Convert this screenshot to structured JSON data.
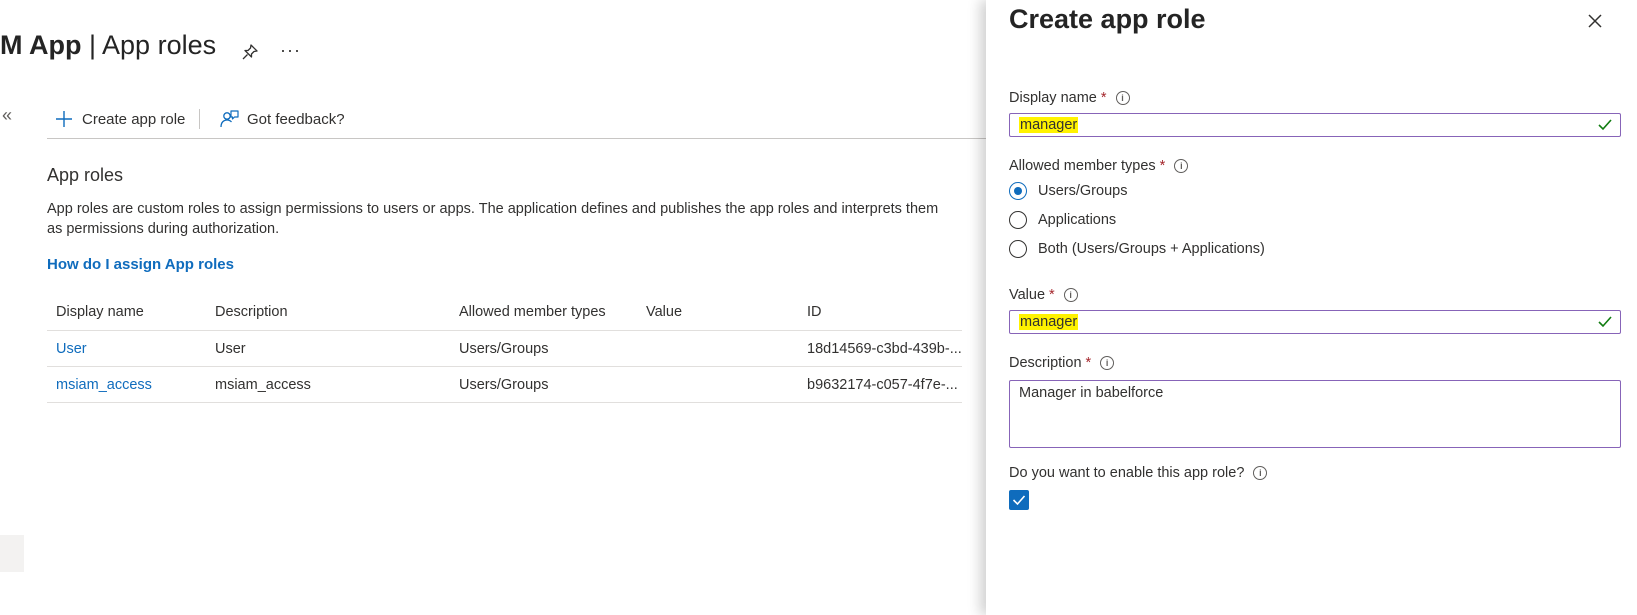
{
  "header": {
    "title_bold": "M App",
    "title_sep": "|",
    "title_rest": "App roles",
    "more_label": "···",
    "collapse_label": "«"
  },
  "toolbar": {
    "create_label": "Create app role",
    "feedback_label": "Got feedback?"
  },
  "section": {
    "title": "App roles",
    "description": "App roles are custom roles to assign permissions to users or apps. The application defines and publishes the app roles and interprets them as permissions during authorization.",
    "help_link": "How do I assign App roles"
  },
  "table": {
    "columns": [
      "Display name",
      "Description",
      "Allowed member types",
      "Value",
      "ID"
    ],
    "rows": [
      {
        "display_name": "User",
        "description": "User",
        "member_types": "Users/Groups",
        "value": "",
        "id": "18d14569-c3bd-439b-..."
      },
      {
        "display_name": "msiam_access",
        "description": "msiam_access",
        "member_types": "Users/Groups",
        "value": "",
        "id": "b9632174-c057-4f7e-..."
      }
    ]
  },
  "panel": {
    "title": "Create app role",
    "display_name_label": "Display name",
    "display_name_value": "manager",
    "member_types_label": "Allowed member types",
    "member_types_options": [
      "Users/Groups",
      "Applications",
      "Both (Users/Groups + Applications)"
    ],
    "member_types_selected": "Users/Groups",
    "value_label": "Value",
    "value_value": "manager",
    "description_label": "Description",
    "description_value": "Manager in babelforce",
    "enable_label": "Do you want to enable this app role?",
    "enable_checked": true,
    "required_mark": "*",
    "info_glyph": "i"
  },
  "colors": {
    "accent": "#0f6cbd",
    "field_border": "#8764b8",
    "valid_check": "#107c10",
    "required": "#a4262c",
    "highlight": "#fff200"
  }
}
